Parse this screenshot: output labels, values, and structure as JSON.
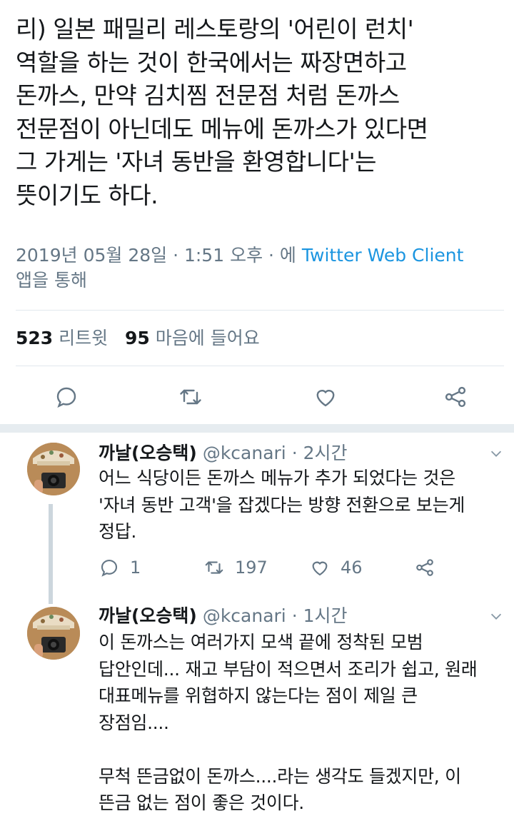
{
  "main_tweet": {
    "text": "리) 일본 패밀리 레스토랑의 '어린이 런치'\n역할을 하는 것이 한국에서는 짜장면하고\n돈까스, 만약 김치찜 전문점 처럼 돈까스\n전문점이 아닌데도 메뉴에 돈까스가 있다면\n그 가게는 '자녀 동반을 환영합니다'는\n뜻이기도 하다.",
    "date": "2019년 05월 28일 · 1:51 오후 · 에 ",
    "client": "Twitter Web Client",
    "via": "앱을 통해",
    "retweet_count": "523",
    "retweet_label": "리트윗",
    "like_count": "95",
    "like_label": "마음에 들어요"
  },
  "actions": {
    "reply": "reply-icon",
    "retweet": "retweet-icon",
    "like": "heart-icon",
    "share": "share-icon"
  },
  "replies": [
    {
      "name": "까날(오승택)",
      "handle": "@kcanari",
      "time": " · 2시간",
      "text": "어느 식당이든 돈까스 메뉴가 추가 되었다는 것은\n'자녀 동반 고객'을 잡겠다는 방향 전환으로 보는게\n정답.",
      "reply_count": "1",
      "retweet_count": "197",
      "like_count": "46"
    },
    {
      "name": "까날(오승택)",
      "handle": "@kcanari",
      "time": " · 1시간",
      "text": "이 돈까스는 여러가지 모색 끝에 정착된 모범\n답안인데... 재고 부담이 적으면서 조리가 쉽고, 원래\n대표메뉴를 위협하지 않는다는 점이 제일 큰\n장점임....\n\n무척 뜬금없이 돈까스....라는 생각도 들겠지만, 이\n뜬금 없는 점이 좋은 것이다."
    }
  ],
  "colors": {
    "text": "#14171a",
    "secondary": "#657786",
    "link": "#1b95e0",
    "divider": "#e1e8ed",
    "thread_line": "#ccd6dd"
  }
}
